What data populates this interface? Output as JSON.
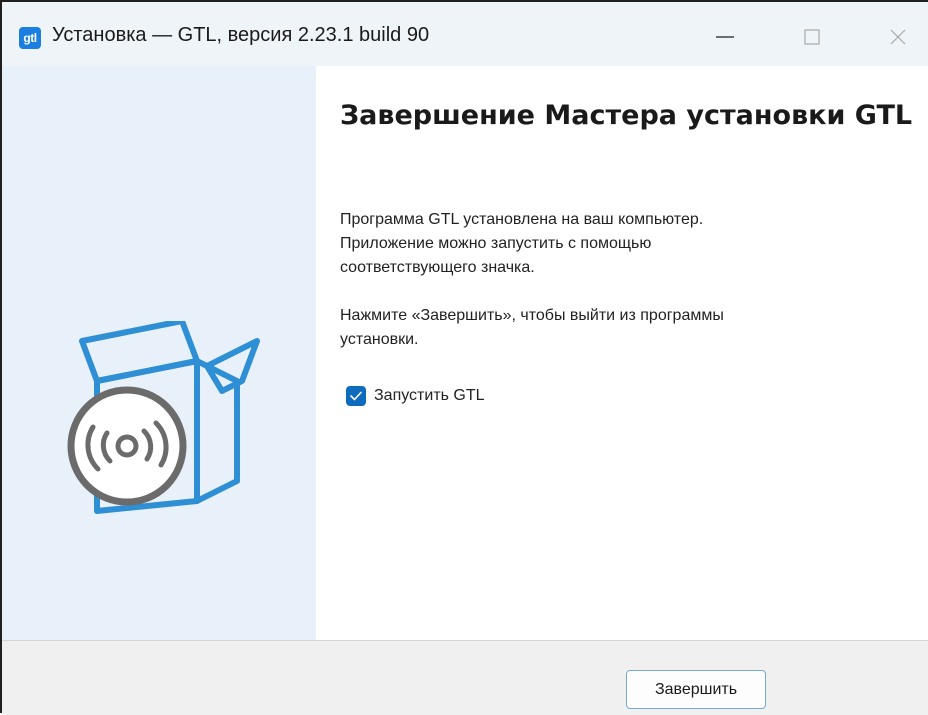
{
  "window": {
    "title": "Установка — GTL, версия 2.23.1 build 90",
    "app_icon_text": "gtl",
    "icons": {
      "minimize": "minimize-icon",
      "maximize": "maximize-icon",
      "close": "close-icon"
    }
  },
  "side_panel": {
    "illustration": "box-with-disc-icon",
    "colors": {
      "background": "#e8f1fa",
      "box_stroke": "#2e8fd4",
      "disc": "#6b6b6b"
    }
  },
  "content": {
    "heading": "Завершение Мастера установки GTL",
    "paragraph1": "Программа GTL установлена на ваш компьютер.\nПриложение можно запустить с помощью\nсоответствующего значка.",
    "paragraph2": "Нажмите «Завершить», чтобы выйти из программы\nустановки.",
    "launch_checkbox": {
      "label": "Запустить GTL",
      "checked": true
    }
  },
  "footer": {
    "finish_label": "Завершить"
  },
  "colors": {
    "accent": "#0f6cbd",
    "titlebar": "#eff4f9",
    "footer": "#f0f0f0"
  }
}
